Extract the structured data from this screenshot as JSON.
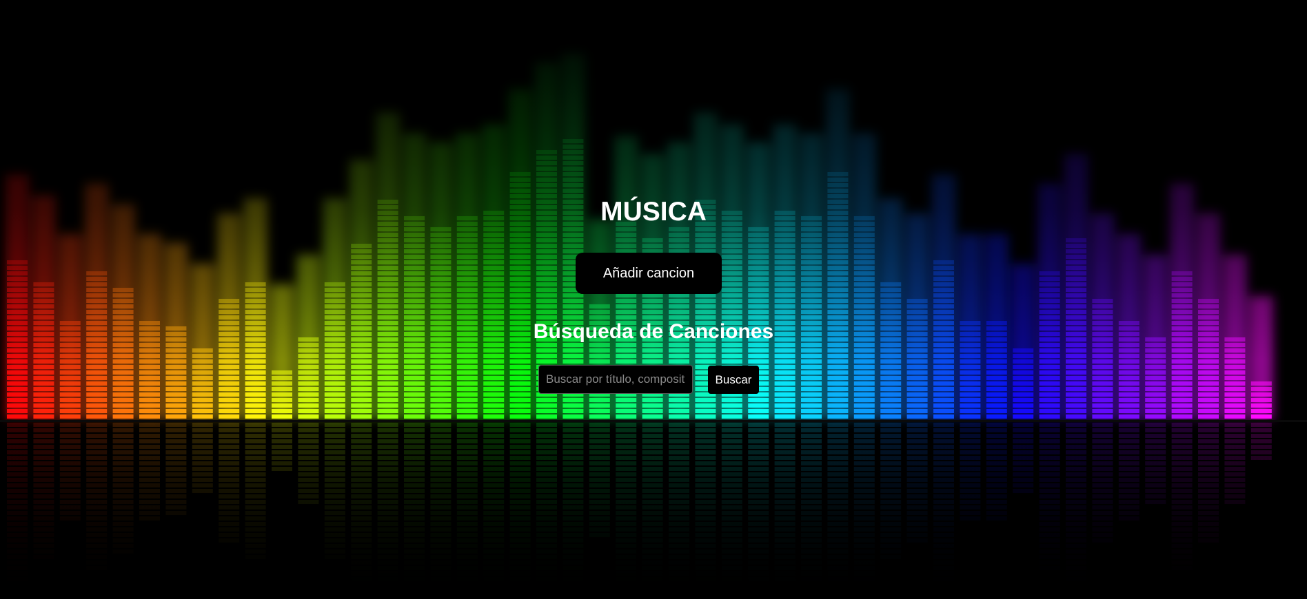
{
  "page": {
    "title": "MÚSICA",
    "add_button_label": "Añadir cancion",
    "search_heading": "Búsqueda de Canciones"
  },
  "search": {
    "placeholder": "Buscar por título, compositor",
    "value": "",
    "button_label": "Buscar"
  },
  "background": {
    "description_icon": "equalizer-bars",
    "bar_heights": [
      0.55,
      0.48,
      0.35,
      0.52,
      0.45,
      0.35,
      0.32,
      0.25,
      0.42,
      0.47,
      0.18,
      0.28,
      0.47,
      0.6,
      0.76,
      0.69,
      0.66,
      0.69,
      0.72,
      0.84,
      0.93,
      0.96,
      0.4,
      0.68,
      0.62,
      0.66,
      0.76,
      0.72,
      0.66,
      0.72,
      0.69,
      0.84,
      0.69,
      0.47,
      0.42,
      0.55,
      0.35,
      0.35,
      0.25,
      0.52,
      0.62,
      0.42,
      0.35,
      0.28,
      0.52,
      0.42,
      0.28,
      0.14
    ],
    "colors": {
      "red": "#ff1a00",
      "yellow": "#ffee22",
      "green": "#22dd44",
      "cyan": "#22e6ee",
      "blue": "#2266ff",
      "purple": "#9a22ff",
      "magenta": "#cc22dd"
    }
  }
}
